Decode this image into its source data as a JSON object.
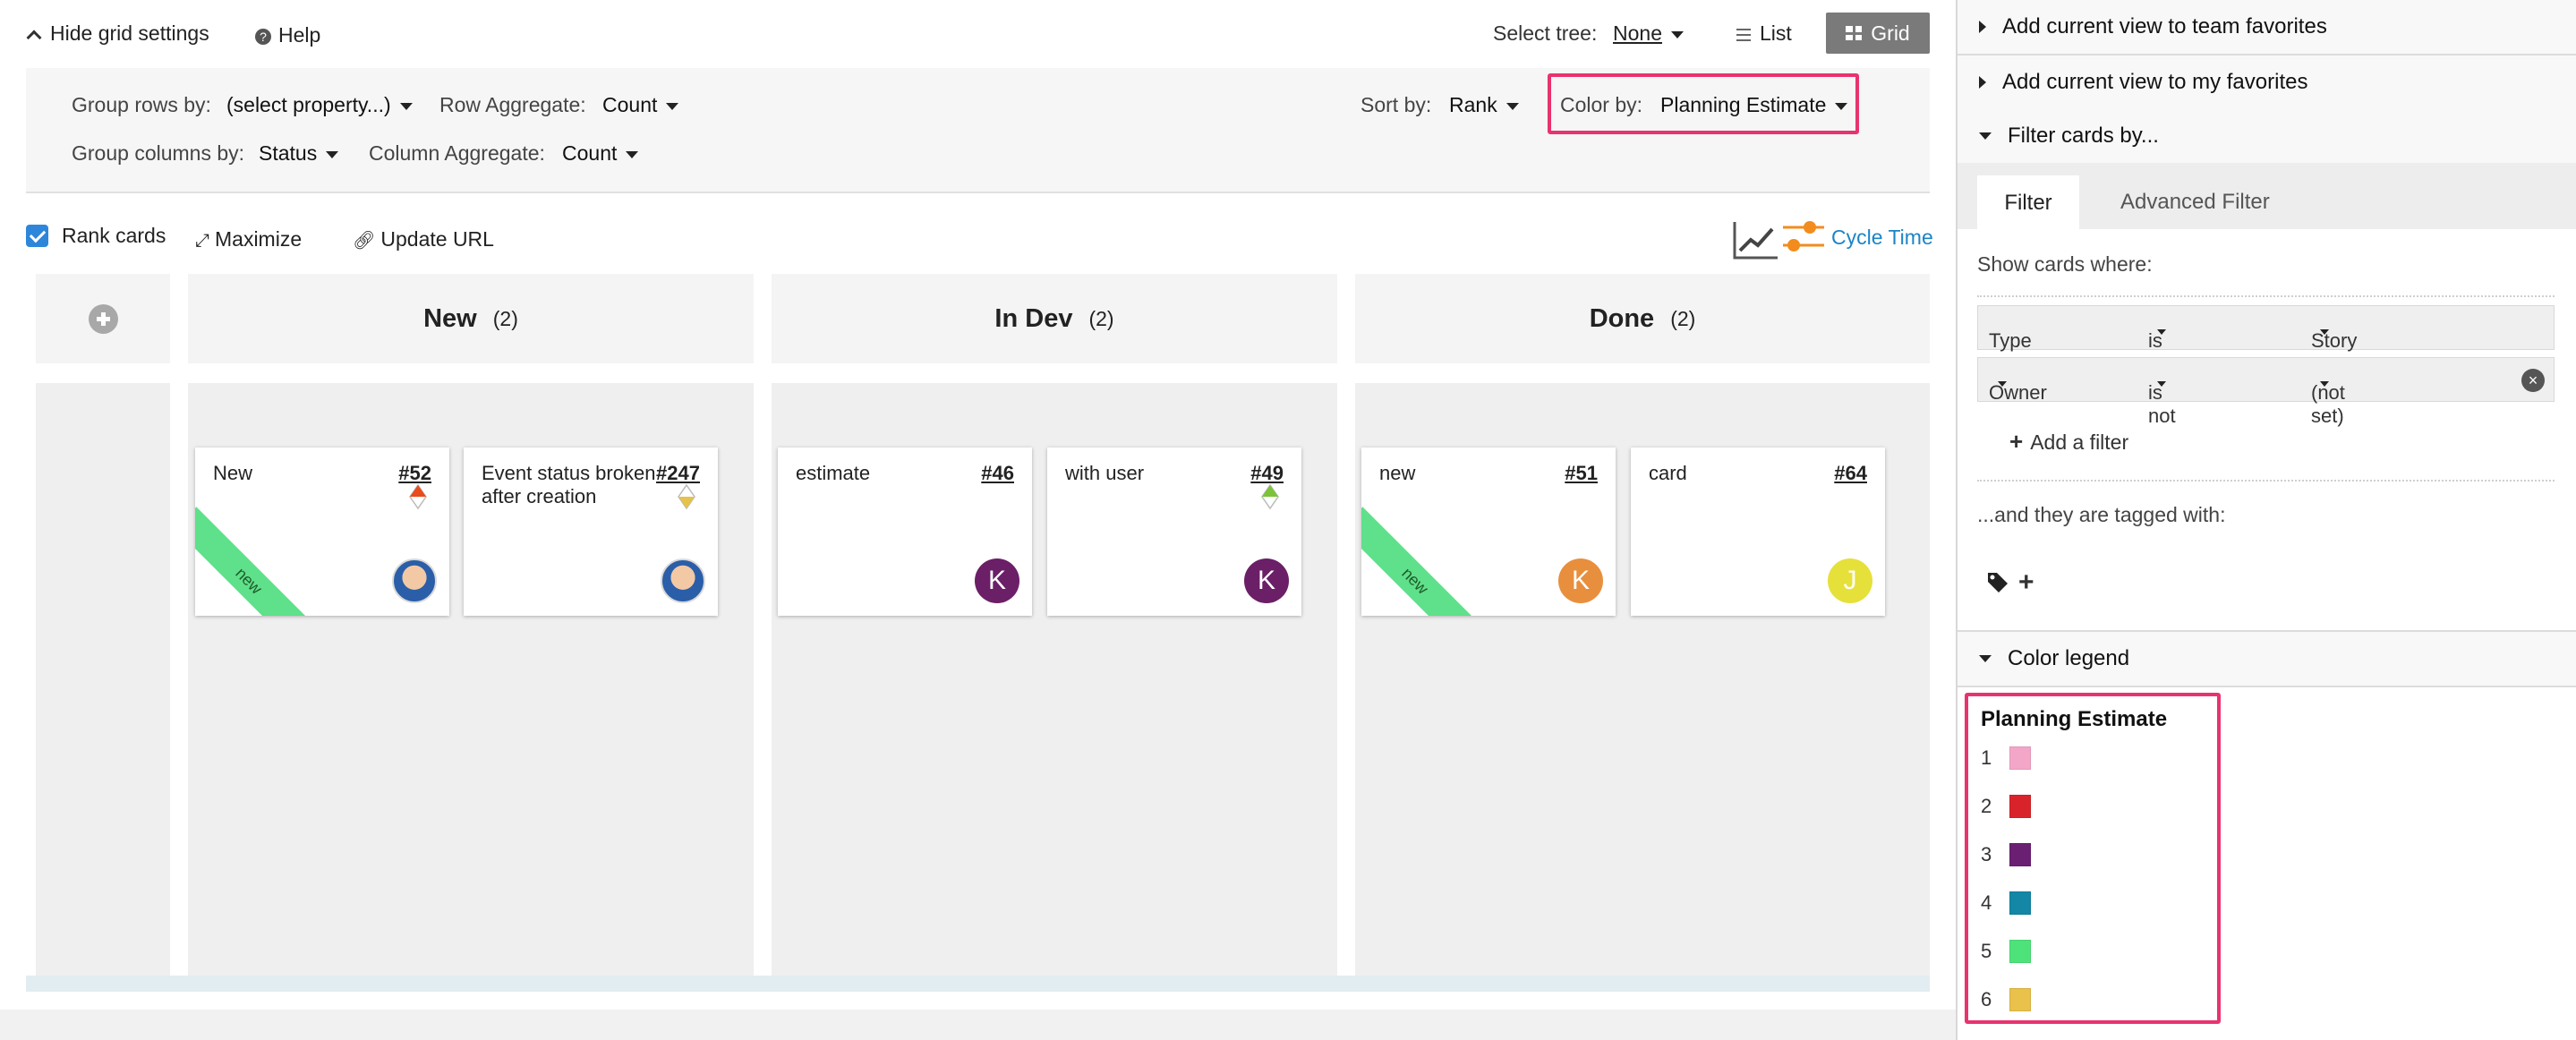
{
  "toolbar": {
    "hide_grid": "Hide grid settings",
    "help": "Help",
    "select_tree_label": "Select tree:",
    "select_tree_value": "None",
    "list": "List",
    "grid": "Grid"
  },
  "settings": {
    "group_rows_label": "Group rows by:",
    "group_rows_value": "(select property...)",
    "row_agg_label": "Row Aggregate:",
    "row_agg_value": "Count",
    "sort_label": "Sort by:",
    "sort_value": "Rank",
    "color_label": "Color by:",
    "color_value": "Planning Estimate",
    "group_cols_label": "Group columns by:",
    "group_cols_value": "Status",
    "col_agg_label": "Column Aggregate:",
    "col_agg_value": "Count"
  },
  "actions": {
    "rank_cards": "Rank cards",
    "maximize": "Maximize",
    "update_url": "Update URL",
    "cycle_time": "Cycle Time"
  },
  "columns": [
    {
      "title": "New",
      "count": "(2)"
    },
    {
      "title": "In Dev",
      "count": "(2)"
    },
    {
      "title": "Done",
      "count": "(2)"
    }
  ],
  "cards": [
    {
      "text": "New",
      "number": "#52",
      "ribbon": "new",
      "avatar": "",
      "avatar_color": "",
      "estimate_color": "#e84b1c"
    },
    {
      "text": "Event status broken after creation",
      "number": "#247",
      "ribbon": "",
      "avatar": "",
      "avatar_color": "",
      "estimate_color": "#e5c24a"
    },
    {
      "text": "estimate",
      "number": "#46",
      "ribbon": "",
      "avatar": "K",
      "avatar_color": "#6b1f67",
      "estimate_color": ""
    },
    {
      "text": "with user",
      "number": "#49",
      "ribbon": "",
      "avatar": "K",
      "avatar_color": "#6b1f67",
      "estimate_color": "#7cc33a"
    },
    {
      "text": "new",
      "number": "#51",
      "ribbon": "new",
      "avatar": "K",
      "avatar_color": "#e88f3e",
      "estimate_color": ""
    },
    {
      "text": "card",
      "number": "#64",
      "ribbon": "",
      "avatar": "J",
      "avatar_color": "#e6e03a",
      "estimate_color": ""
    }
  ],
  "sidebar": {
    "team_fav": "Add current view to team favorites",
    "my_fav": "Add current view to my favorites",
    "filter_by": "Filter cards by...",
    "tab_filter": "Filter",
    "tab_advanced": "Advanced Filter",
    "show_where": "Show cards where:",
    "filters": [
      {
        "field": "Type",
        "op": "is",
        "value": "Story"
      },
      {
        "field": "Owner",
        "op": "is not",
        "value": "(not set)"
      }
    ],
    "add_filter": "Add a filter",
    "tagged_with": "...and they are tagged with:",
    "color_legend": "Color legend"
  },
  "legend": {
    "title": "Planning Estimate",
    "items": [
      {
        "label": "1",
        "color": "#f4a6c8"
      },
      {
        "label": "2",
        "color": "#d9232a"
      },
      {
        "label": "3",
        "color": "#6b1f73"
      },
      {
        "label": "4",
        "color": "#1387a5"
      },
      {
        "label": "5",
        "color": "#4ee37a"
      },
      {
        "label": "6",
        "color": "#e9c14b"
      }
    ]
  }
}
